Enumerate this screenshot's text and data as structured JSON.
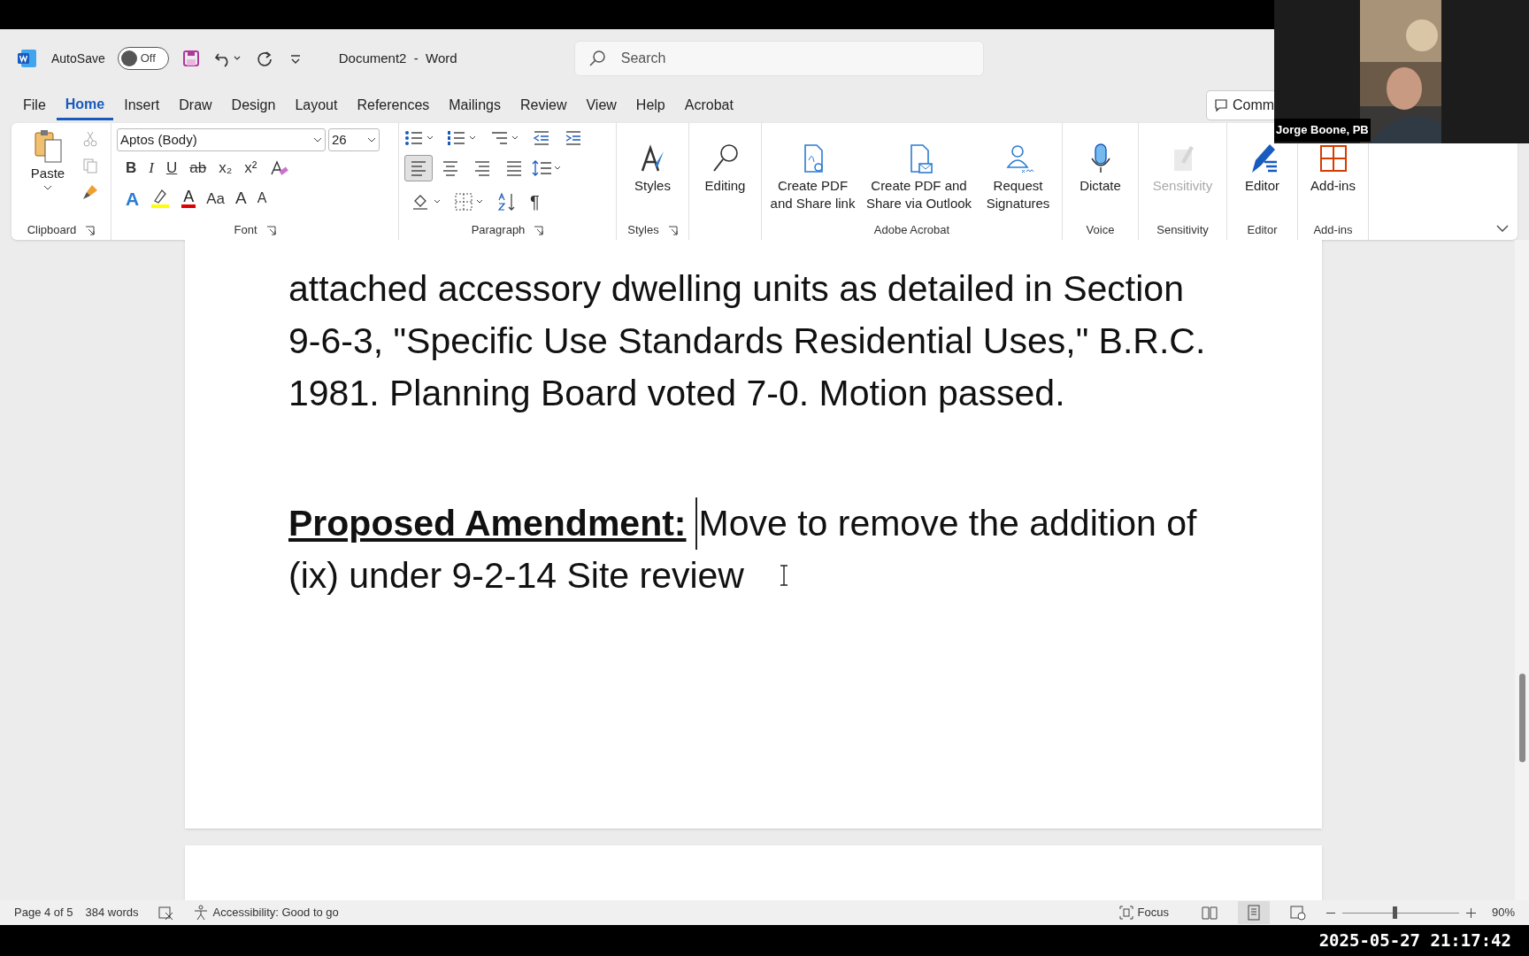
{
  "title_bar": {
    "autosave_label": "AutoSave",
    "autosave": {
      "on": false,
      "label": "Off"
    },
    "document_title": "Document2  -  Word",
    "search": {
      "placeholder": "Search"
    }
  },
  "menu_tabs": [
    {
      "label": "File",
      "selected": false
    },
    {
      "label": "Home",
      "selected": true
    },
    {
      "label": "Insert",
      "selected": false
    },
    {
      "label": "Draw",
      "selected": false
    },
    {
      "label": "Design",
      "selected": false
    },
    {
      "label": "Layout",
      "selected": false
    },
    {
      "label": "References",
      "selected": false
    },
    {
      "label": "Mailings",
      "selected": false
    },
    {
      "label": "Review",
      "selected": false
    },
    {
      "label": "View",
      "selected": false
    },
    {
      "label": "Help",
      "selected": false
    },
    {
      "label": "Acrobat",
      "selected": false
    }
  ],
  "comments_button": "Comm",
  "ribbon": {
    "paste": "Paste",
    "font_name": "Aptos (Body)",
    "font_size": "26",
    "font_buttons": [
      "B",
      "I",
      "U",
      "ab",
      "x₂",
      "x²"
    ],
    "font_buttons_2": [
      "A",
      "A",
      "Aa",
      "A",
      "A"
    ],
    "align_buttons": [
      {
        "kind": "left",
        "selected": true
      },
      {
        "kind": "center",
        "selected": false
      },
      {
        "kind": "right",
        "selected": false
      },
      {
        "kind": "justify",
        "selected": false
      }
    ],
    "pilcrow": "¶",
    "groups": [
      {
        "label": "Clipboard"
      },
      {
        "label": "Font"
      },
      {
        "label": "Paragraph"
      },
      {
        "label": "Styles"
      },
      {
        "label": "Adobe Acrobat"
      },
      {
        "label": "Voice"
      },
      {
        "label": "Sensitivity"
      },
      {
        "label": "Editor"
      },
      {
        "label": "Add-ins"
      }
    ],
    "big_buttons": [
      {
        "kind": "styles",
        "label": "Styles",
        "disabled": false
      },
      {
        "kind": "editing",
        "label": "Editing",
        "disabled": false
      },
      {
        "kind": "pdf_link",
        "label": "Create PDF and Share link",
        "disabled": false
      },
      {
        "kind": "pdf_mail",
        "label": "Create PDF and Share via Outlook",
        "disabled": false
      },
      {
        "kind": "sign",
        "label": "Request Signatures",
        "disabled": false
      },
      {
        "kind": "dictate",
        "label": "Dictate",
        "disabled": false
      },
      {
        "kind": "sensitivity",
        "label": "Sensitivity",
        "disabled": true
      },
      {
        "kind": "editor",
        "label": "Editor",
        "disabled": false
      },
      {
        "kind": "addins",
        "label": "Add-ins",
        "disabled": false
      }
    ]
  },
  "document": {
    "paragraph_lines": [
      "attached accessory dwelling units as detailed in Section",
      "9-6-3, \"Specific Use Standards Residential Uses,\" B.R.C.",
      "1981. Planning Board voted 7-0. Motion passed."
    ],
    "amendment": {
      "label": "Proposed Amendment:",
      "lines": [
        "Move to remove the addition of",
        "(ix) under 9-2-14 Site review"
      ]
    }
  },
  "status_bar": {
    "page": "Page 4 of 5",
    "words": "384 words",
    "accessibility": "Accessibility: Good to go",
    "focus": "Focus",
    "zoom": {
      "level": 0.45,
      "label": "90%"
    }
  },
  "video_tile": {
    "name": "Jorge Boone, PB"
  },
  "timestamp": "2025-05-27 21:17:42"
}
